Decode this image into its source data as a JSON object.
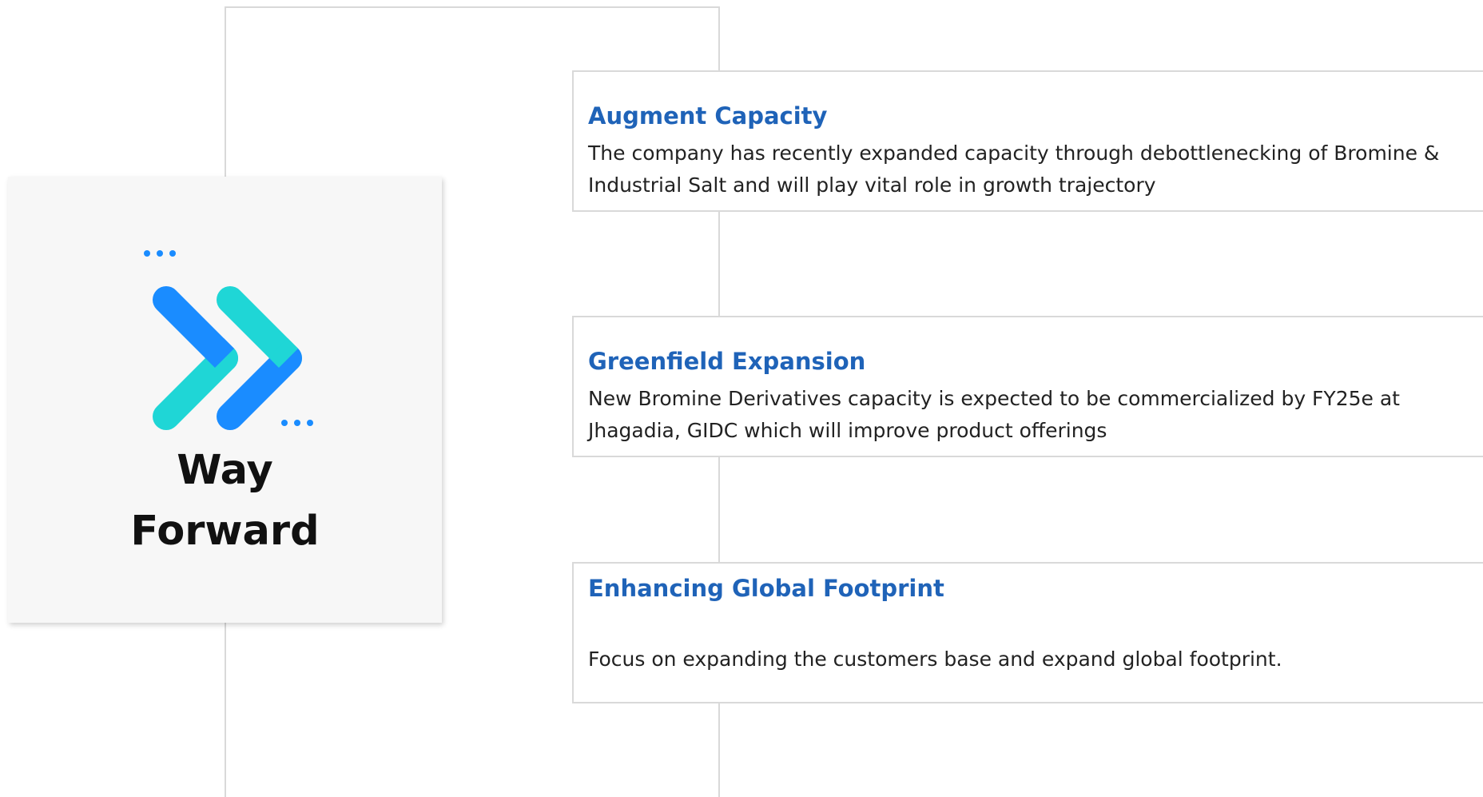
{
  "hero": {
    "title_line1": "Way",
    "title_line2": "Forward",
    "icon": "double-chevron-forward-icon",
    "colors": {
      "chevron_blue": "#1a8cff",
      "chevron_teal": "#1fd6d6",
      "dots": "#1a8cff"
    }
  },
  "items": [
    {
      "title": "Augment Capacity",
      "description": "The company has recently expanded capacity through debottlenecking of Bromine & Industrial Salt and will play vital role in growth trajectory"
    },
    {
      "title": "Greenfield Expansion",
      "description": "New Bromine Derivatives capacity is expected to be commercialized by FY25e at Jhagadia, GIDC which will improve product offerings"
    },
    {
      "title": "Enhancing Global Footprint",
      "description": "Focus on expanding the customers base and expand global footprint."
    }
  ],
  "colors": {
    "title_blue": "#1f63b8",
    "border_gray": "#d9d9d9",
    "panel_bg": "#f7f7f7"
  }
}
